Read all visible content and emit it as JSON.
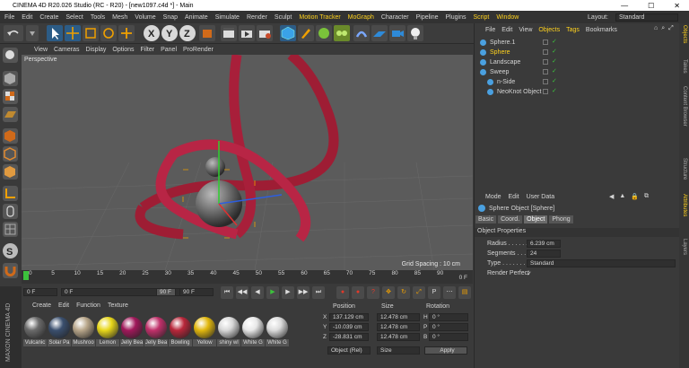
{
  "window": {
    "title": "CINEMA 4D R20.026 Studio (RC - R20) - [new1097.c4d *] - Main",
    "controls": [
      "—",
      "☐",
      "✕"
    ]
  },
  "menu": [
    "File",
    "Edit",
    "Create",
    "Select",
    "Tools",
    "Mesh",
    "Volume",
    "Snap",
    "Animate",
    "Simulate",
    "Render",
    "Sculpt",
    "Motion Tracker",
    "MoGraph",
    "Character",
    "Pipeline",
    "Plugins",
    "Script",
    "Window"
  ],
  "layout": {
    "label": "Layout:",
    "value": "Standard"
  },
  "viewport": {
    "menu": [
      "View",
      "Cameras",
      "Display",
      "Options",
      "Filter",
      "Panel",
      "ProRender"
    ],
    "camera": "Perspective",
    "grid_spacing": "Grid Spacing : 10 cm"
  },
  "timeline": {
    "ticks": [
      "0",
      "5",
      "10",
      "15",
      "20",
      "25",
      "30",
      "35",
      "40",
      "45",
      "50",
      "55",
      "60",
      "65",
      "70",
      "75",
      "80",
      "85",
      "90"
    ],
    "end_label": "0 F",
    "start": "0 F",
    "current": "0 F",
    "end": "90 F",
    "end2": "90 F"
  },
  "objects": {
    "menu": [
      "File",
      "Edit",
      "View",
      "Objects",
      "Tags",
      "Bookmarks"
    ],
    "items": [
      {
        "name": "Sphere.1",
        "indent": 0,
        "selected": false
      },
      {
        "name": "Sphere",
        "indent": 0,
        "selected": true
      },
      {
        "name": "Landscape",
        "indent": 0,
        "selected": false
      },
      {
        "name": "Sweep",
        "indent": 0,
        "selected": false
      },
      {
        "name": "n-Side",
        "indent": 1,
        "selected": false
      },
      {
        "name": "NeoKnot Object",
        "indent": 1,
        "selected": false
      }
    ]
  },
  "attributes": {
    "menu": [
      "Mode",
      "Edit",
      "User Data"
    ],
    "object_title": "Sphere Object [Sphere]",
    "tabs": [
      "Basic",
      "Coord.",
      "Object",
      "Phong"
    ],
    "section": "Object Properties",
    "fields": [
      {
        "label": "Radius . . . . . . .",
        "value": "6.239 cm"
      },
      {
        "label": "Segments . . . .",
        "value": "24"
      },
      {
        "label": "Type . . . . . . . .",
        "value": "Standard"
      },
      {
        "label": "Render Perfect",
        "value": "✓"
      }
    ]
  },
  "side_tabs": [
    "Objects",
    "Takes",
    "Content Browser",
    "Structure",
    "Attributes",
    "Layers"
  ],
  "materials": {
    "menu": [
      "Create",
      "Edit",
      "Function",
      "Texture"
    ],
    "items": [
      {
        "name": "Vulcanic",
        "color": "#6a6a6a"
      },
      {
        "name": "Solar Pa",
        "color": "#3a4f6e"
      },
      {
        "name": "Mushroo",
        "color": "#b8a68a"
      },
      {
        "name": "Lemon",
        "color": "#e8d71a"
      },
      {
        "name": "Jelly Bea",
        "color": "#a0185a"
      },
      {
        "name": "Jelly Bea",
        "color": "#c0306a"
      },
      {
        "name": "Bowling",
        "color": "#b8263a"
      },
      {
        "name": "Yellow",
        "color": "#e2b80e"
      },
      {
        "name": "shiny wl",
        "color": "#d8d8d8"
      },
      {
        "name": "White G",
        "color": "#e8e8e8"
      },
      {
        "name": "White G",
        "color": "#dcdcdc"
      }
    ]
  },
  "coordinates": {
    "headers": [
      "Position",
      "Size",
      "Rotation"
    ],
    "rows": [
      {
        "axis": "X",
        "pos": "137.129 cm",
        "size": "12.478 cm",
        "rot_label": "H",
        "rot": "0 °"
      },
      {
        "axis": "Y",
        "pos": "-10.039 cm",
        "size": "12.478 cm",
        "rot_label": "P",
        "rot": "0 °"
      },
      {
        "axis": "Z",
        "pos": "-28.831 cm",
        "size": "12.478 cm",
        "rot_label": "B",
        "rot": "0 °"
      }
    ],
    "mode1": "Object (Rel)",
    "mode2": "Size",
    "apply": "Apply"
  },
  "logo": "MAXON CINEMA 4D"
}
